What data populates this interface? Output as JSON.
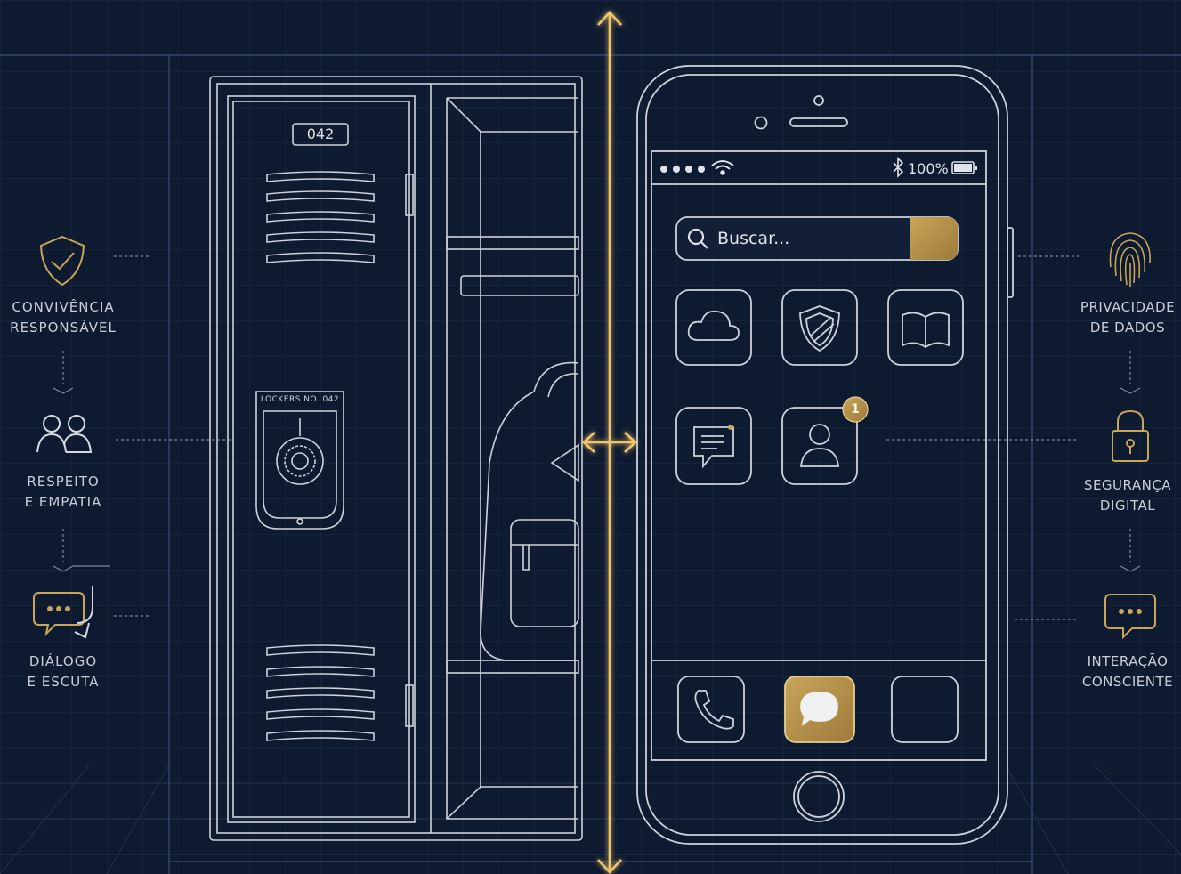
{
  "locker": {
    "number": "042",
    "plate_text": "LOCKERS NO. 042"
  },
  "phone": {
    "status": {
      "signal_icon": "signal-dots-icon",
      "wifi_icon": "wifi-icon",
      "bluetooth_icon": "bluetooth-icon",
      "battery_text": "100%",
      "battery_icon": "battery-icon"
    },
    "search": {
      "placeholder": "Buscar..."
    },
    "apps": [
      {
        "icon": "cloud-icon"
      },
      {
        "icon": "shield-icon"
      },
      {
        "icon": "book-icon"
      },
      {
        "icon": "message-icon"
      },
      {
        "icon": "profile-icon",
        "badge": "1"
      }
    ],
    "dock": [
      {
        "icon": "phone-icon"
      },
      {
        "icon": "chat-bubble-icon"
      },
      {
        "icon": "blank-app-icon"
      }
    ]
  },
  "left_concepts": [
    {
      "icon": "shield-check-icon",
      "line1": "CONVIVÊNCIA",
      "line2": "RESPONSÁVEL"
    },
    {
      "icon": "people-icon",
      "line1": "RESPEITO",
      "line2": "E EMPATIA"
    },
    {
      "icon": "speech-bubbles-icon",
      "line1": "DIÁLOGO",
      "line2": "E ESCUTA"
    }
  ],
  "right_concepts": [
    {
      "icon": "fingerprint-icon",
      "line1": "PRIVACIDADE",
      "line2": "DE DADOS"
    },
    {
      "icon": "padlock-icon",
      "line1": "SEGURANÇA",
      "line2": "DIGITAL"
    },
    {
      "icon": "chat-dots-icon",
      "line1": "INTERAÇÃO",
      "line2": "CONSCIENTE"
    }
  ],
  "colors": {
    "background": "#0e1a30",
    "line": "#cdd3dc",
    "gold": "#c9a55a",
    "gold_glow": "#f0c46a",
    "grid": "#1d2c48"
  }
}
